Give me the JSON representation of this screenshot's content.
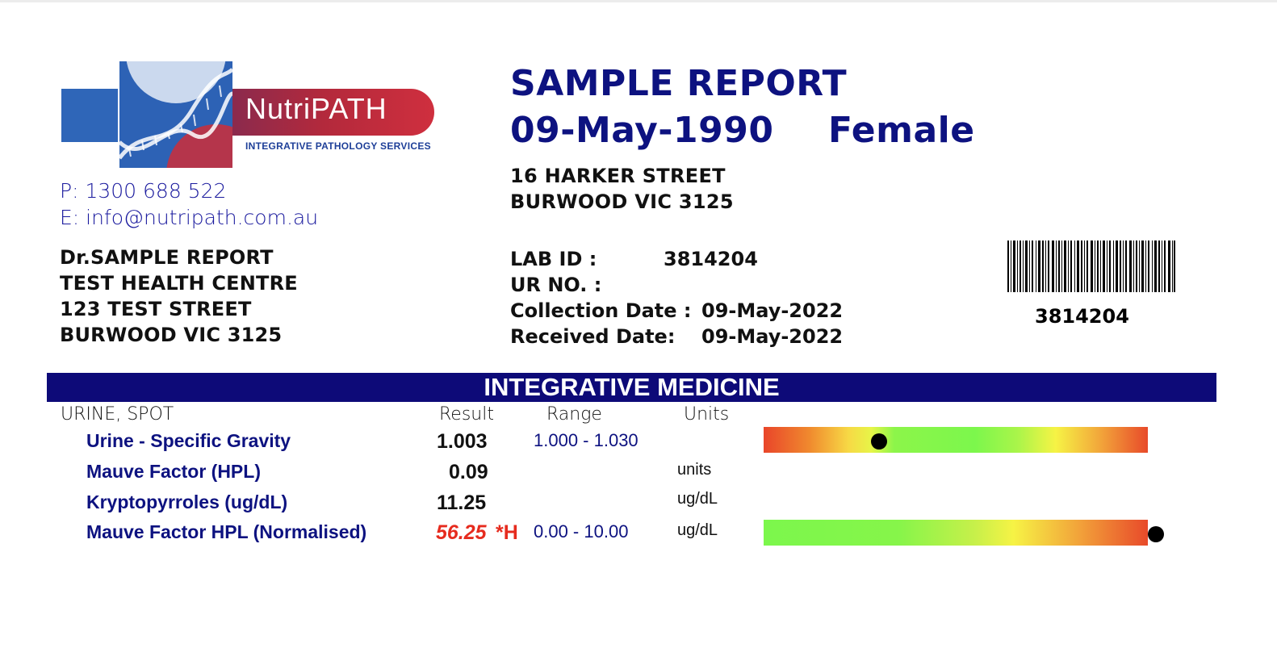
{
  "logo": {
    "brand": "NutriPATH",
    "tagline": "INTEGRATIVE PATHOLOGY SERVICES"
  },
  "contact": {
    "phone": "P: 1300 688 522",
    "email": "E: info@nutripath.com.au"
  },
  "doctor": {
    "name": "Dr.SAMPLE REPORT",
    "practice": "TEST HEALTH CENTRE",
    "street": "123 TEST STREET",
    "suburb": "BURWOOD VIC 3125"
  },
  "patient": {
    "name": "SAMPLE REPORT",
    "dob": "09-May-1990",
    "sex": "Female",
    "street": "16  HARKER STREET",
    "suburb": "BURWOOD VIC 3125"
  },
  "lab": {
    "lab_id_label": "LAB ID :",
    "lab_id": "3814204",
    "ur_label": "UR NO. :",
    "collection_label": "Collection Date :",
    "collection_date": "09-May-2022",
    "received_label": "Received Date:",
    "received_date": "09-May-2022",
    "barcode_number": "3814204"
  },
  "section": {
    "title": "INTEGRATIVE MEDICINE",
    "specimen": "URINE, SPOT",
    "headers": {
      "result": "Result",
      "range": "Range",
      "units": "Units"
    }
  },
  "tests": [
    {
      "name": "Urine - Specific Gravity",
      "result": "1.003",
      "flag": "",
      "range": "1.000 - 1.030",
      "units": "",
      "gauge_level": 0.3
    },
    {
      "name": "Mauve Factor (HPL)",
      "result": "0.09",
      "flag": "",
      "range": "",
      "units": "units"
    },
    {
      "name": "Kryptopyrroles (ug/dL)",
      "result": "11.25",
      "flag": "",
      "range": "",
      "units": "ug/dL"
    },
    {
      "name": "Mauve Factor HPL (Normalised)",
      "result": "56.25",
      "flag": "*H",
      "range": "0.00 - 10.00",
      "units": "ug/dL",
      "gauge_level": 1.0
    }
  ],
  "colors": {
    "brand_navy": "#0d1280",
    "banner": "#0d0a78",
    "high_flag": "#e62b1e"
  }
}
